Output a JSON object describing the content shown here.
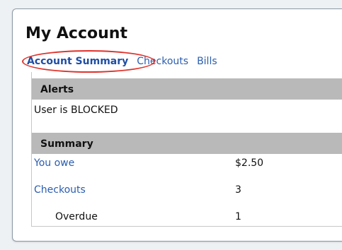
{
  "account": {
    "title": "My Account",
    "tabs": [
      {
        "label": "Account Summary",
        "active": true
      },
      {
        "label": "Checkouts",
        "active": false
      },
      {
        "label": "Bills",
        "active": false
      }
    ]
  },
  "alerts": {
    "header": "Alerts",
    "message": "User is BLOCKED"
  },
  "summary": {
    "header": "Summary",
    "rows": [
      {
        "label": "You owe",
        "value": "$2.50"
      },
      {
        "label": "Checkouts",
        "value": "3"
      },
      {
        "label": "Overdue",
        "value": "1"
      }
    ]
  },
  "colors": {
    "link": "#2a5db0",
    "band": "#b9b9b9",
    "highlight_circle": "#e0322b"
  }
}
